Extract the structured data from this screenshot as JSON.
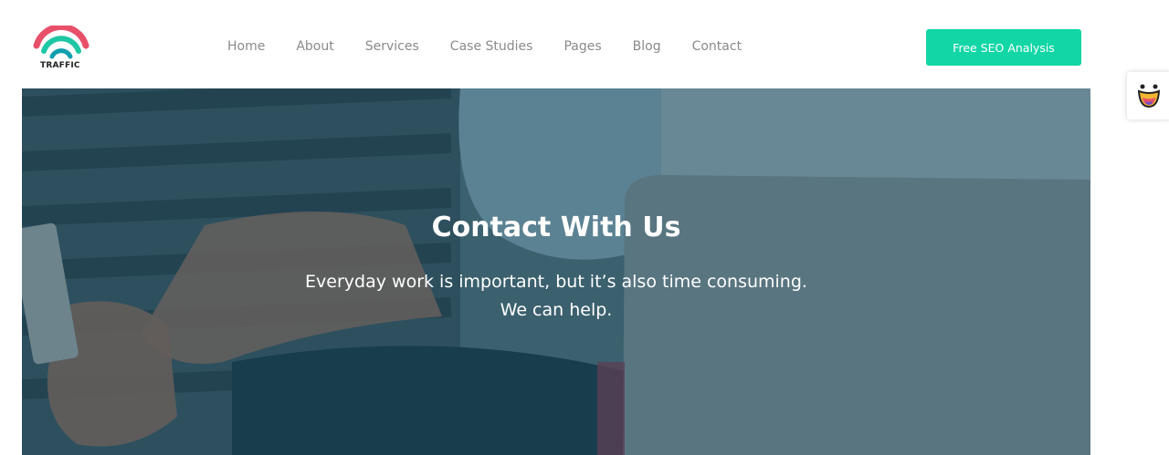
{
  "header": {
    "logo_text": "TRAFFIC",
    "nav": [
      "Home",
      "About",
      "Services",
      "Case Studies",
      "Pages",
      "Blog",
      "Contact"
    ],
    "cta_label": "Free SEO Analysis"
  },
  "hero": {
    "title": "Contact With Us",
    "subtitle_line1": "Everyday work is important, but it’s also time consuming.",
    "subtitle_line2": "We can help."
  },
  "colors": {
    "accent": "#13d6a6",
    "logo_red": "#e8506a",
    "logo_teal": "#1fc7a5",
    "nav_text": "#8a8a8a"
  },
  "icons": {
    "side_widget": "emoji-face-icon"
  }
}
